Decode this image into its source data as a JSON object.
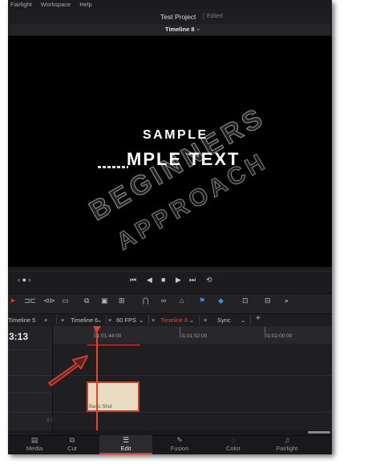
{
  "menu": [
    "Fairlight",
    "Workspace",
    "Help"
  ],
  "project": {
    "title": "Test Project",
    "status": "Edited"
  },
  "timeline_name": "Timeline 8",
  "viewer": {
    "line1": "SAMPLE",
    "line2": "MPLE TEXT"
  },
  "watermark": {
    "line1": "BEGINNERS",
    "line2": "APPROACH"
  },
  "timeline_tabs": [
    "Timeline 5",
    "Timeline 6",
    "60 FPS",
    "Timeline 8",
    "Sync"
  ],
  "timecode": "3:13",
  "ruler": [
    "01:01:44:00",
    "01:01:52:00",
    "01:02:00:00"
  ],
  "track_scale": "2.0",
  "clip_label": "Basic Shot",
  "pages": [
    "Media",
    "Cut",
    "Edit",
    "Fusion",
    "Color",
    "Fairlight"
  ],
  "colors": {
    "accent": "#e8412c",
    "clip": "#e7dcc0",
    "background": "#1c1c1e"
  }
}
